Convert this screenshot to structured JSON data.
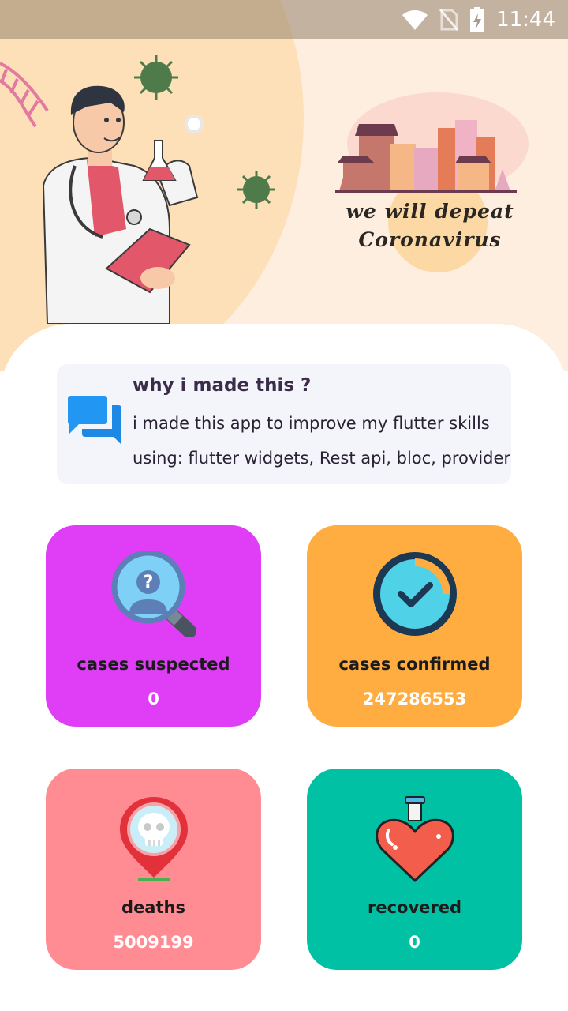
{
  "status_bar": {
    "time": "11:44"
  },
  "hero": {
    "slogan_line1": "we will depeat",
    "slogan_line2": "Coronavirus"
  },
  "info": {
    "title": "why i made this ?",
    "line1": "i made this app to improve my flutter skills",
    "line2": "using: flutter widgets, Rest api, bloc, provider"
  },
  "stats": [
    {
      "label": "cases suspected",
      "value": "0",
      "color": "#df3df6",
      "icon": "magnifier-person-icon"
    },
    {
      "label": "cases confirmed",
      "value": "247286553",
      "color": "#ffac40",
      "icon": "check-circle-icon"
    },
    {
      "label": "deaths",
      "value": "5009199",
      "color": "#ff8b93",
      "icon": "skull-pin-icon"
    },
    {
      "label": "recovered",
      "value": "0",
      "color": "#00c1a4",
      "icon": "heart-potion-icon"
    }
  ]
}
